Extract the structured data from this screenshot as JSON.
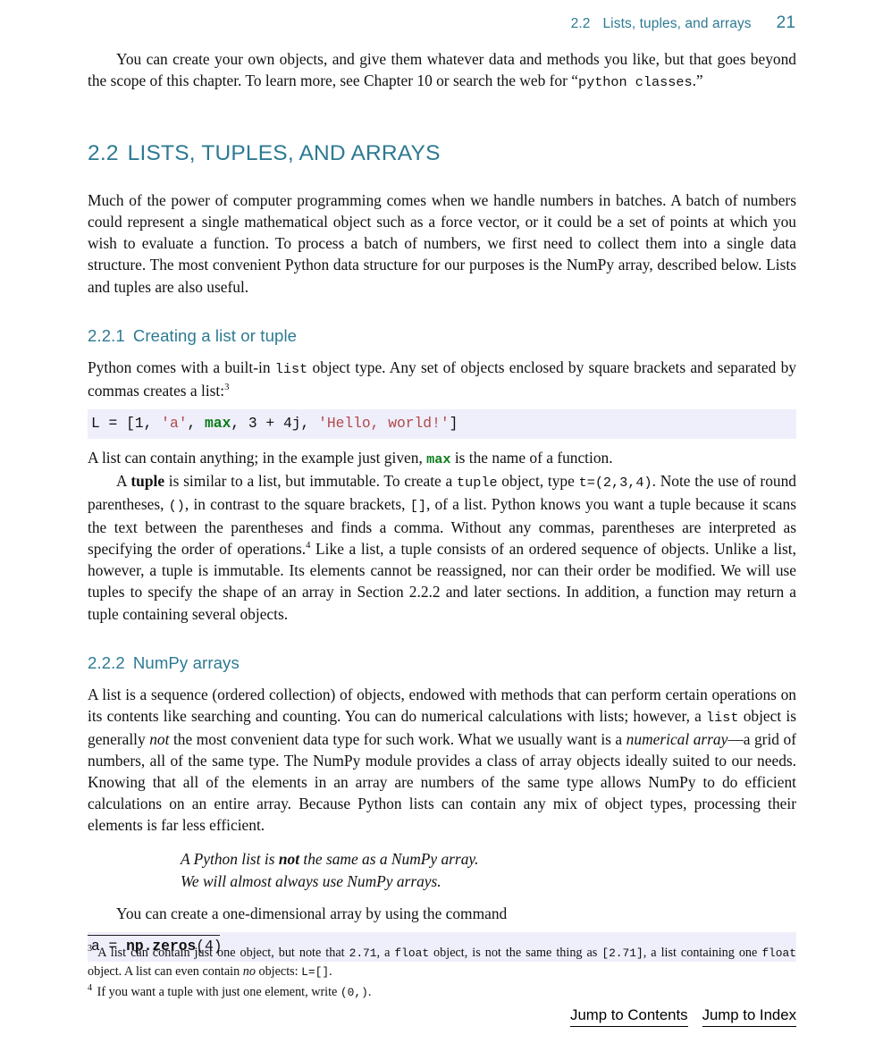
{
  "running_head": {
    "section_number": "2.2",
    "section_title": "Lists, tuples, and arrays",
    "page_number": "21",
    "color": "#2d7a93"
  },
  "intro_paragraph": {
    "part1": "You can create your own objects, and give them whatever data and methods you like, but that goes beyond the scope of this chapter. To learn more, see Chapter 10 or search the web for “",
    "code": "python classes",
    "part2": ".”"
  },
  "section": {
    "number": "2.2",
    "title": "LISTS, TUPLES, AND ARRAYS",
    "body": "Much of the power of computer programming comes when we handle numbers in batches. A batch of numbers could represent a single mathematical object such as a force vector, or it could be a set of points at which you wish to evaluate a function. To process a batch of numbers, we first need to collect them into a single data structure. The most convenient Python data structure for our purposes is the NumPy array, described below. Lists and tuples are also useful."
  },
  "subsection_221": {
    "number": "2.2.1",
    "title": "Creating a list or tuple",
    "p1_a": "Python comes with a built-in ",
    "p1_code": "list",
    "p1_b": " object type. Any set of objects enclosed by square brackets and separated by commas creates a list:",
    "p1_footnote_ref": "3",
    "code_block": {
      "t1": "L = [1, ",
      "s1": "'a'",
      "t2": ", ",
      "kw": "max",
      "t3": ", 3 + 4j, ",
      "s2": "'Hello, world!'",
      "t4": "]"
    },
    "p2_a": "A list can contain anything; in the example just given, ",
    "p2_code": "max",
    "p2_b": " is the name of a function.",
    "p3_a": "A ",
    "p3_bold": "tuple",
    "p3_b": " is similar to a list, but immutable. To create a ",
    "p3_c1": "tuple",
    "p3_c": " object, type ",
    "p3_c2": "t=(2,3,4)",
    "p3_d": ". Note the use of round parentheses, ",
    "p3_c3": "()",
    "p3_e": ", in contrast to the square brackets, ",
    "p3_c4": "[]",
    "p3_f": ", of a list. Python knows you want a tuple because it scans the text between the parentheses and finds a comma. Without any commas, parentheses are interpreted as specifying the order of operations.",
    "p3_footnote_ref": "4",
    "p3_g": " Like a list, a tuple consists of an ordered sequence of objects. Unlike a list, however, a tuple is immutable. Its elements cannot be reassigned, nor can their order be modified. We will use tuples to specify the shape of an array in Section 2.2.2 and later sections. In addition, a function may return a tuple containing several objects."
  },
  "subsection_222": {
    "number": "2.2.2",
    "title": "NumPy arrays",
    "p1_a": "A list is a sequence (ordered collection) of objects, endowed with methods that can perform certain operations on its contents like searching and counting. You can do numerical calculations with lists; however, a ",
    "p1_code": "list",
    "p1_b": " object is generally ",
    "p1_italic1": "not",
    "p1_c": " the most convenient data type for such work. What we usually want is a ",
    "p1_italic2": "numerical array",
    "p1_d": "—a grid of numbers, all of the same type. The NumPy module provides a class of array objects ideally suited to our needs. Knowing that all of the elements in an array are numbers of the same type allows NumPy to do efficient calculations on an entire array. Because Python lists can contain any mix of object types, processing their elements is far less efficient.",
    "callout_line1_a": "A Python list is ",
    "callout_line1_bold": "not",
    "callout_line1_b": " the same as a NumPy array.",
    "callout_line2": "We will almost always use NumPy arrays.",
    "p2": "You can create a one-dimensional array by using the command",
    "code_block": {
      "t1": "a = ",
      "bold": "np.zeros",
      "t2": "(4)"
    }
  },
  "footnotes": [
    {
      "mark": "3",
      "a": " A list can contain just one object, but note that ",
      "c1": "2.71",
      "b": ", a ",
      "c2": "float",
      "c": " object, is not the same thing as ",
      "c3": "[2.71]",
      "d": ", a list containing one ",
      "c4": "float",
      "e": " object. A list can even contain ",
      "italic": "no",
      "f": " objects: ",
      "c5": "L=[]",
      "g": "."
    },
    {
      "mark": "4",
      "a": " If you want a tuple with just one element, write ",
      "c1": "(0,)",
      "b": "."
    }
  ],
  "bottom_nav": {
    "contents_label": "Jump to Contents",
    "index_label": "Jump to Index"
  },
  "colors": {
    "heading": "#2d7a93",
    "code_bg": "#efeefb",
    "string": "#b04a4a",
    "keyword": "#0a7d19",
    "text": "#111111"
  }
}
